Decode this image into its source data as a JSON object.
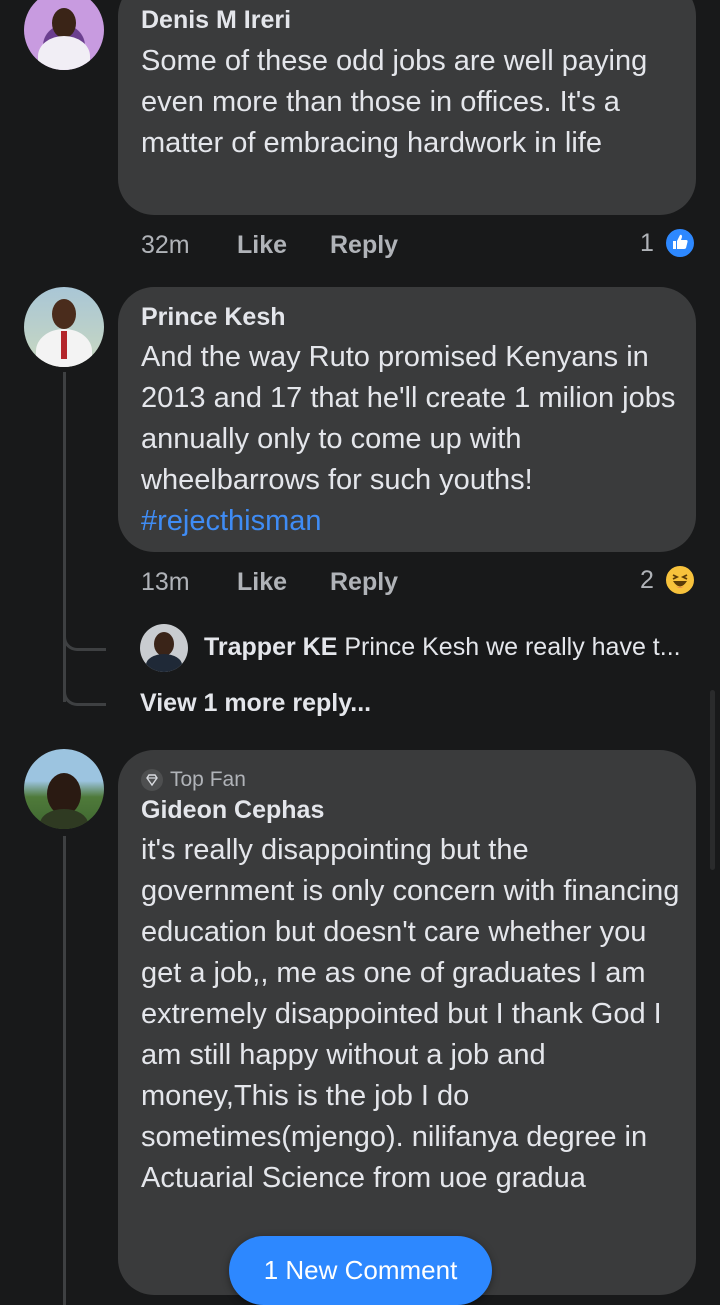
{
  "comments": [
    {
      "author": "Denis M Ireri",
      "text": "Some of these odd jobs are well paying even more than those in offices. It's a matter of embracing hardwork in life",
      "time": "32m",
      "like": "Like",
      "reply": "Reply",
      "reaction_count": "1",
      "reaction_icon": "like-icon"
    },
    {
      "author": "Prince Kesh",
      "text": "And the way Ruto promised Kenyans in 2013 and 17 that he'll create 1 milion jobs annually only to come up with wheelbarrows for such youths!",
      "hashtag": "#rejecthisman",
      "time": "13m",
      "like": "Like",
      "reply": "Reply",
      "reaction_count": "2",
      "reaction_icon": "haha-icon",
      "reply_preview": {
        "author": "Trapper KE",
        "text": "Prince Kesh we really have t..."
      },
      "view_more": "View 1 more reply..."
    },
    {
      "badge": "Top Fan",
      "author": "Gideon Cephas",
      "text": "it's really disappointing but the government is only concern with financing education but doesn't care whether you get a job,, me as one of graduates I am extremely disappointed but I thank God I am still happy without a job and money,This is the job I do sometimes(mjengo). nilifanya degree in Actuarial Science from uoe gradua"
    }
  ],
  "new_comment_button": "1 New Comment",
  "colors": {
    "background": "#18191a",
    "bubble": "#3a3b3c",
    "accent": "#2d88ff",
    "hashtag": "#3f8cf5"
  }
}
